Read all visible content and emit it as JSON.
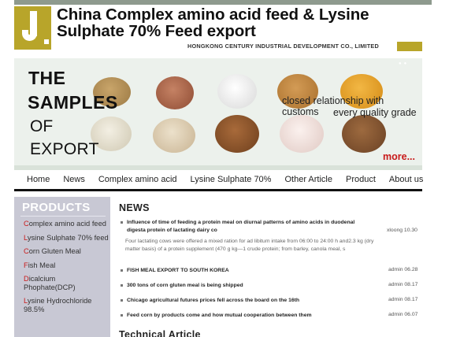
{
  "header": {
    "logo_letter": "J.",
    "title_line1": "China Complex amino acid feed & Lysine",
    "title_line2": "Sulphate 70% Feed export",
    "company": "HONGKONG CENTURY INDUSTRIAL DEVELOPMENT CO., LIMITED"
  },
  "banner": {
    "line1": "THE",
    "line2": "SAMPLES",
    "line3": "OF",
    "line4": "EXPORT",
    "slogan1": "closed relationship with customs",
    "slogan2": "every quality grade",
    "more_label": "more..."
  },
  "nav": {
    "items": [
      "Home",
      "News",
      "Complex amino acid",
      "Lysine Sulphate 70%",
      "Other Article",
      "Product",
      "About us"
    ]
  },
  "sidebar": {
    "title": "PRODUCTS",
    "items": [
      {
        "first": "C",
        "rest": "omplex amino acid feed"
      },
      {
        "first": "L",
        "rest": "ysine Sulphate 70% feed"
      },
      {
        "first": "C",
        "rest": "orn Gluten Meal"
      },
      {
        "first": "F",
        "rest": "ish Meal"
      },
      {
        "first": "D",
        "rest": "icalcium Phophate(DCP)"
      },
      {
        "first": "L",
        "rest": "ysine Hydrochloride 98.5%"
      }
    ]
  },
  "news": {
    "title": "NEWS",
    "featured": {
      "line1": "Influence of time of feeding a protein meal on diurnal patterns of amino acids in duodenal",
      "line2": "digesta protein of lactating dairy co",
      "meta": "xloong 10.30",
      "desc1": "Four lactating cows were offered a mixed ration for ad libitum intake from 06:00 to 24:00 h and2.3 kg (dry",
      "desc2": "matter basis) of a protein supplement (470 g kg—1 crude protein; from barley, canola meal, s"
    },
    "items": [
      {
        "title": "FISH MEAL EXPORT TO SOUTH KOREA",
        "meta": "admin 06.28"
      },
      {
        "title": "300 tons of corn gluten meal is being shipped",
        "meta": "admin 08.17"
      },
      {
        "title": "Chicago agricultural futures prices fell across the board on the 16th",
        "meta": "admin 08.17"
      },
      {
        "title": "Feed corn by products come and how mutual cooperation between them",
        "meta": "admin 06.07"
      }
    ]
  },
  "technical": {
    "title": "Technical Article"
  },
  "colors": {
    "brand_gold": "#b8a52a",
    "accent_red": "#c81a1a",
    "sidebar_bg": "#c8c8d4"
  }
}
